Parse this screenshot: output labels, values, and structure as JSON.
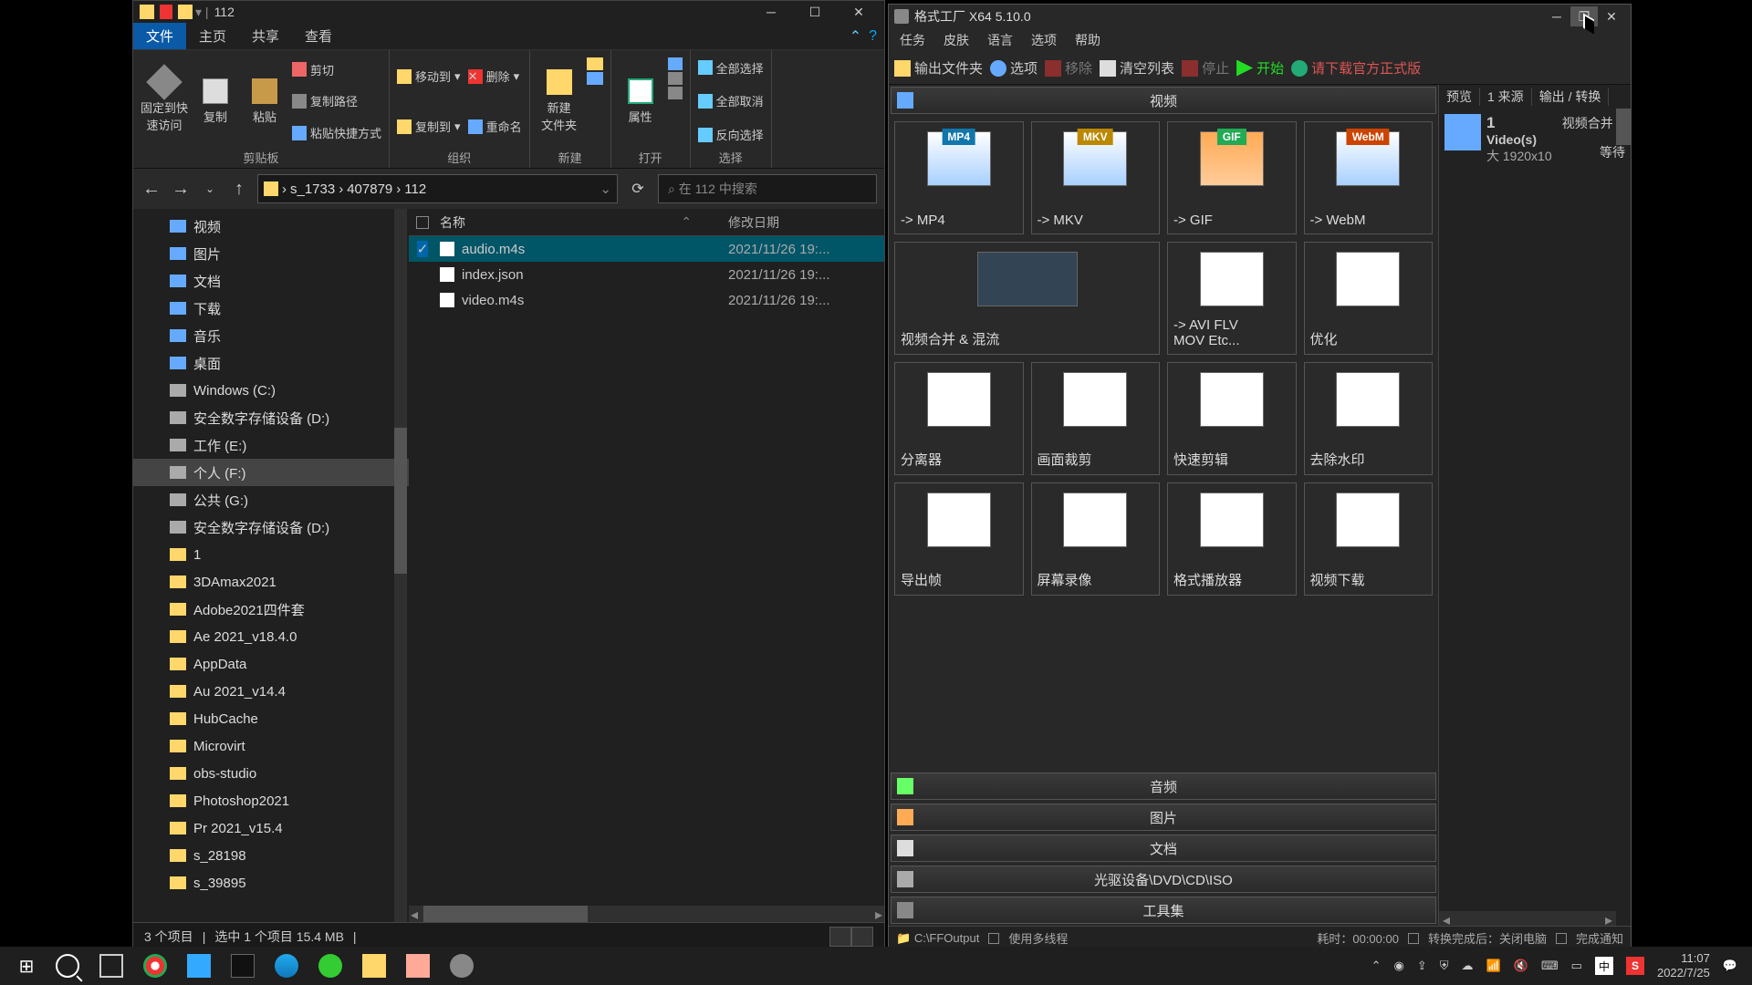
{
  "explorer": {
    "title": "112",
    "tabs": [
      "文件",
      "主页",
      "共享",
      "查看"
    ],
    "active_tab": 0,
    "ribbon": {
      "clipboard": {
        "label": "剪贴板",
        "pin": "固定到快\n速访问",
        "copy": "复制",
        "paste": "粘贴",
        "cut": "剪切",
        "copypath": "复制路径",
        "shortcut": "粘贴快捷方式"
      },
      "organize": {
        "label": "组织",
        "move": "移动到",
        "copy_to": "复制到",
        "delete": "删除",
        "rename": "重命名"
      },
      "new": {
        "label": "新建",
        "newfolder": "新建\n文件夹"
      },
      "open": {
        "label": "打开",
        "props": "属性"
      },
      "select": {
        "label": "选择",
        "all": "全部选择",
        "none": "全部取消",
        "inv": "反向选择"
      }
    },
    "breadcrumb": [
      "s_1733",
      "407879",
      "112"
    ],
    "search_ph": "在 112 中搜索",
    "columns": {
      "name": "名称",
      "date": "修改日期"
    },
    "files": [
      {
        "name": "audio.m4s",
        "date": "2021/11/26 19:...",
        "sel": true
      },
      {
        "name": "index.json",
        "date": "2021/11/26 19:...",
        "sel": false
      },
      {
        "name": "video.m4s",
        "date": "2021/11/26 19:...",
        "sel": false
      }
    ],
    "tree": [
      {
        "name": "视频",
        "ic": "lib"
      },
      {
        "name": "图片",
        "ic": "lib"
      },
      {
        "name": "文档",
        "ic": "lib"
      },
      {
        "name": "下载",
        "ic": "lib"
      },
      {
        "name": "音乐",
        "ic": "lib"
      },
      {
        "name": "桌面",
        "ic": "lib"
      },
      {
        "name": "Windows (C:)",
        "ic": "drive"
      },
      {
        "name": "安全数字存储设备 (D:)",
        "ic": "drive"
      },
      {
        "name": "工作 (E:)",
        "ic": "drive"
      },
      {
        "name": "个人 (F:)",
        "ic": "drive",
        "sel": true
      },
      {
        "name": "公共 (G:)",
        "ic": "drive"
      },
      {
        "name": "安全数字存储设备 (D:)",
        "ic": "drive",
        "indent": 0
      },
      {
        "name": "1",
        "ic": "f"
      },
      {
        "name": "3DAmax2021",
        "ic": "f"
      },
      {
        "name": "Adobe2021四件套",
        "ic": "f"
      },
      {
        "name": "Ae 2021_v18.4.0",
        "ic": "f"
      },
      {
        "name": "AppData",
        "ic": "f"
      },
      {
        "name": "Au 2021_v14.4",
        "ic": "f"
      },
      {
        "name": "HubCache",
        "ic": "f"
      },
      {
        "name": "Microvirt",
        "ic": "f"
      },
      {
        "name": "obs-studio",
        "ic": "f"
      },
      {
        "name": "Photoshop2021",
        "ic": "f"
      },
      {
        "name": "Pr 2021_v15.4",
        "ic": "f"
      },
      {
        "name": "s_28198",
        "ic": "f"
      },
      {
        "name": "s_39895",
        "ic": "f"
      }
    ],
    "status": {
      "items": "3 个项目",
      "sel": "选中 1 个项目  15.4 MB"
    }
  },
  "ff": {
    "title": "格式工厂 X64 5.10.0",
    "menu": [
      "任务",
      "皮肤",
      "语言",
      "选项",
      "帮助"
    ],
    "toolbar": {
      "output": "输出文件夹",
      "options": "选项",
      "remove": "移除",
      "clear": "清空列表",
      "stop": "停止",
      "start": "开始",
      "dl": "请下载官方正式版"
    },
    "categories": {
      "video": "视频",
      "audio": "音频",
      "picture": "图片",
      "doc": "文档",
      "disc": "光驱设备\\DVD\\CD\\ISO",
      "tools": "工具集"
    },
    "items": [
      {
        "lbl": "-> MP4",
        "fmt": "MP4",
        "cls": "mp4"
      },
      {
        "lbl": "-> MKV",
        "fmt": "MKV",
        "cls": "mkv"
      },
      {
        "lbl": "-> GIF",
        "fmt": "GIF",
        "cls": "gif"
      },
      {
        "lbl": "-> WebM",
        "fmt": "WebM",
        "cls": "webm"
      },
      {
        "lbl": "视频合并 & 混流",
        "cls": "merge"
      },
      {
        "lbl": "-> AVI FLV\nMOV Etc...",
        "cls": "etc"
      },
      {
        "lbl": "优化",
        "cls": "opt"
      },
      {
        "lbl": "分离器",
        "cls": "split"
      },
      {
        "lbl": "画面裁剪",
        "cls": "crop"
      },
      {
        "lbl": "快速剪辑",
        "cls": "trim"
      },
      {
        "lbl": "去除水印",
        "cls": "wm"
      },
      {
        "lbl": "导出帧",
        "cls": "frame"
      },
      {
        "lbl": "屏幕录像",
        "cls": "rec"
      },
      {
        "lbl": "格式播放器",
        "cls": "player"
      },
      {
        "lbl": "视频下载",
        "cls": "vdl"
      }
    ],
    "right": {
      "hdr": [
        "预览",
        "1  来源",
        "输出 / 转换"
      ],
      "task_count": "1",
      "task_lbl": "Video(s)",
      "task_size": "大 1920x10",
      "task_name": "视频合并 &",
      "task_st": "等待"
    },
    "status": {
      "path": "C:\\FFOutput",
      "thread": "使用多线程",
      "time": "耗时：00:00:00",
      "after": "转换完成后：关闭电脑",
      "notify": "完成通知"
    }
  },
  "taskbar": {
    "time": "11:07",
    "date": "2022/7/25",
    "ime": "中"
  }
}
